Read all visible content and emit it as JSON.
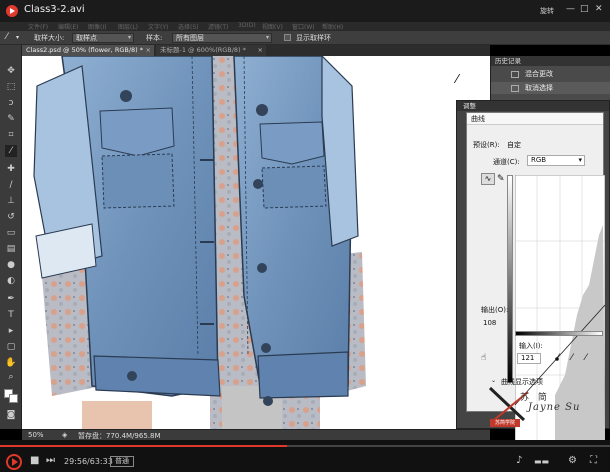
{
  "player": {
    "title": "Class3-2.avi",
    "version": "旋转",
    "time": "29:56/63:33",
    "badge": "普通",
    "progress": 0.471,
    "accent": "#e0392c"
  },
  "menubar": [
    "文件(F)",
    "编辑(E)",
    "图像(I)",
    "图层(L)",
    "文字(Y)",
    "选择(S)",
    "滤镜(T)",
    "3D(D)",
    "视图(V)",
    "窗口(W)",
    "帮助(H)"
  ],
  "options": {
    "sample_size_label": "取样大小:",
    "sample_size_value": "取样点",
    "sample_label": "样本:",
    "sample_value": "所有图层",
    "show_ring_label": "显示取样环"
  },
  "tabs": [
    {
      "label": "Class2.psd @ 50% (flower, RGB/8) *",
      "active": true
    },
    {
      "label": "未标题-1 @ 600%(RGB/8) *",
      "active": false
    }
  ],
  "status": {
    "zoom": "50%",
    "doc": "暂存盘：770.4M/965.8M"
  },
  "history": {
    "title": "历史记录",
    "items": [
      "混合更改",
      "取消选择"
    ]
  },
  "adjust": {
    "title": "调整"
  },
  "curves": {
    "title": "曲线",
    "preset_label": "预设(R):",
    "preset_value": "自定",
    "channel_label": "通道(C):",
    "channel_value": "RGB",
    "output_label": "输出(O):",
    "output_value": "108",
    "input_label": "输入(I):",
    "input_value": "121",
    "display_options": "曲线显示选项"
  },
  "watermark": {
    "cn": "苏 简",
    "en": "Jayne Su",
    "stamp": "苏简学院"
  }
}
